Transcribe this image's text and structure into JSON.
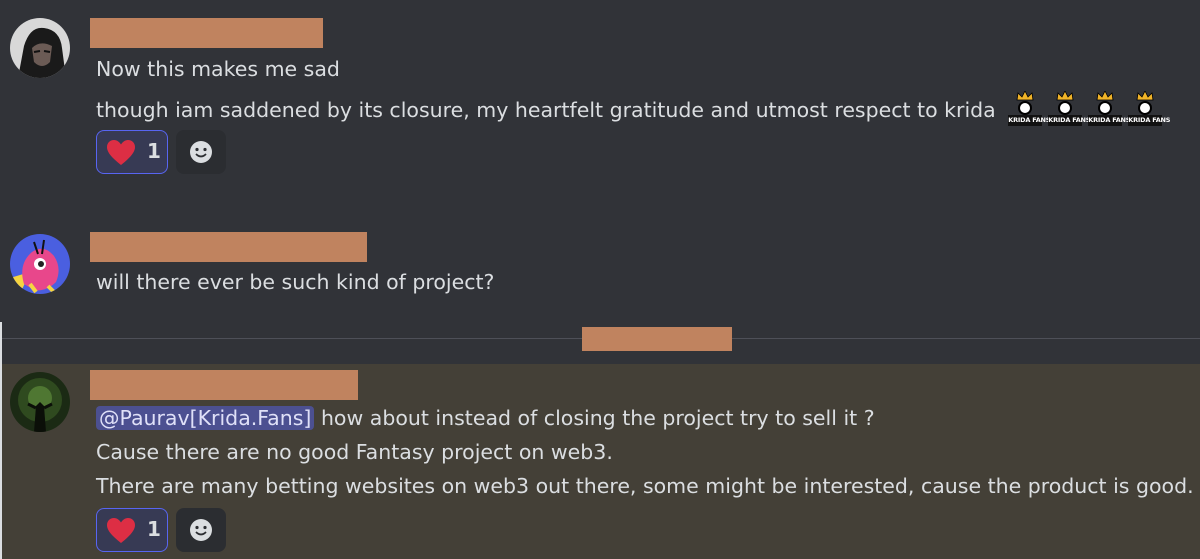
{
  "messages": [
    {
      "avatar_icon": "user-avatar-dark-figure",
      "lines": [
        "Now this makes me sad",
        "though iam saddened by its closure, my heartfelt gratitude and utmost respect to krida"
      ],
      "badges": [
        "KRIDA FANS",
        "KRIDA FANS",
        "KRIDA FANS",
        "KRIDA FANS"
      ],
      "reaction": {
        "icon": "heart-icon",
        "count": "1"
      }
    },
    {
      "avatar_icon": "user-avatar-pink-creature",
      "lines": [
        "will there ever be such kind of project?"
      ]
    },
    {
      "avatar_icon": "user-avatar-green-figure",
      "mention": "@Paurav[Krida.Fans]",
      "lines": [
        " how about instead of closing the project try to sell it ?",
        "Cause there are no good Fantasy project on web3.",
        "There are many betting websites on web3 out there, some might be interested, cause the product is good."
      ],
      "reaction": {
        "icon": "heart-icon",
        "count": "1"
      }
    }
  ],
  "colors": {
    "background": "#313338",
    "highlight": "#444037",
    "redaction": "#c0835f",
    "reaction_border": "#5865f2",
    "heart": "#dd2e44"
  }
}
